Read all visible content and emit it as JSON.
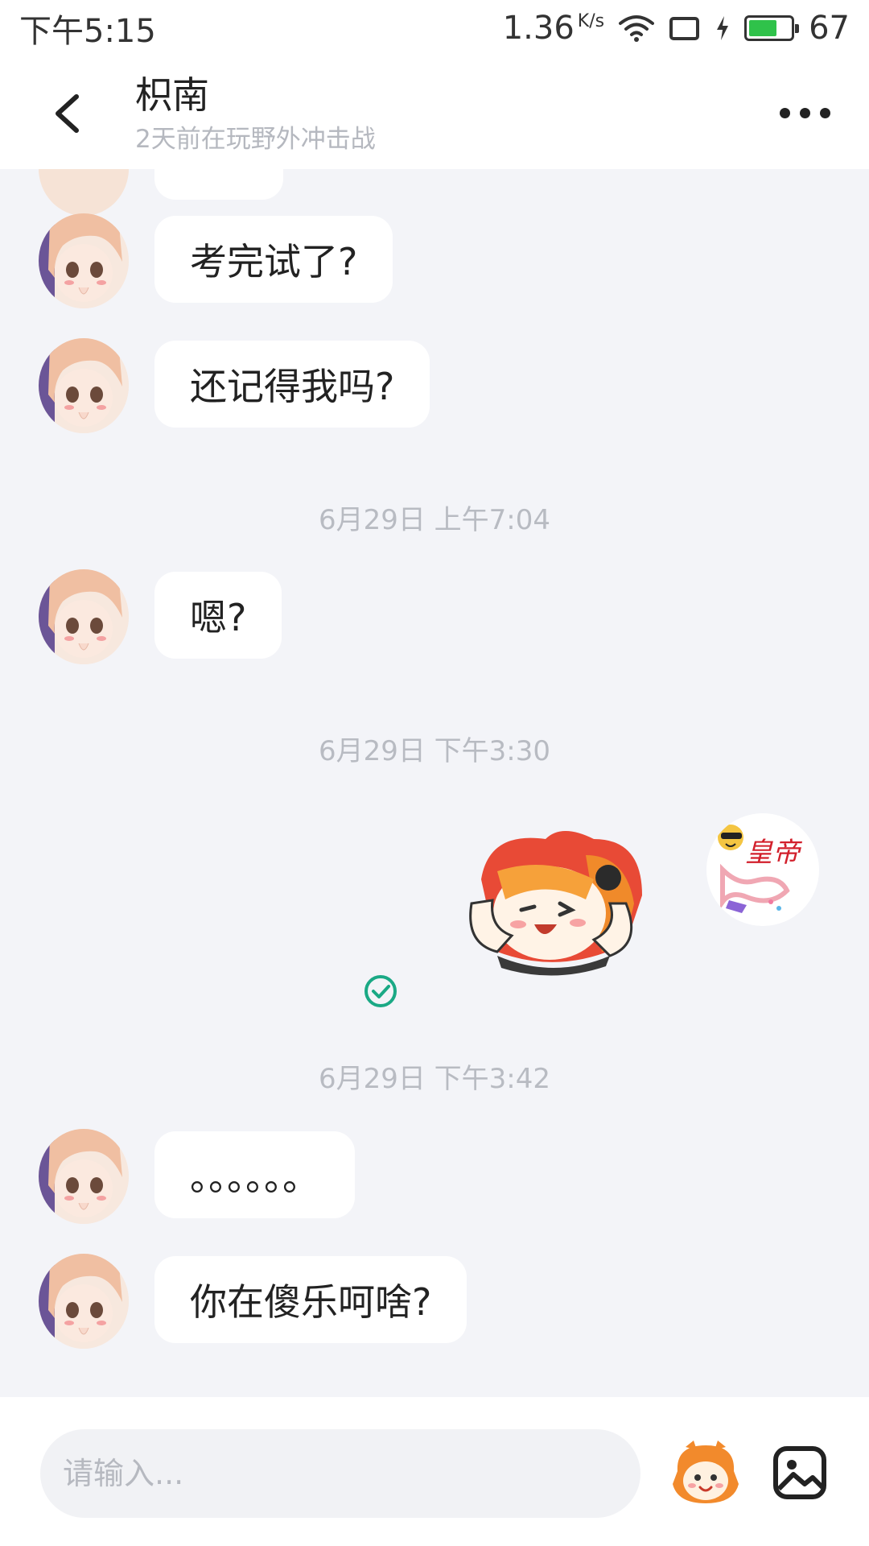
{
  "status_bar": {
    "time": "下午5:15",
    "speed": "1.36",
    "speed_unit": "K/s",
    "battery": "67"
  },
  "header": {
    "contact_name": "枳南",
    "contact_status": "2天前在玩野外冲击战"
  },
  "messages": [
    {
      "text": "考完试了?"
    },
    {
      "text": "还记得我吗?"
    },
    {
      "timestamp": "6月29日 上午7:04"
    },
    {
      "text": "嗯?"
    },
    {
      "timestamp": "6月29日 下午3:30"
    },
    {
      "timestamp": "6月29日 下午3:42"
    },
    {
      "text": "。。。。。。"
    },
    {
      "text": "你在傻乐呵啥?"
    }
  ],
  "sent_avatar_text": "皇帝",
  "input": {
    "placeholder": "请输入..."
  },
  "colors": {
    "accent_check": "#1aa985",
    "bubble": "#ffffff",
    "chat_bg": "#f3f4f8"
  }
}
